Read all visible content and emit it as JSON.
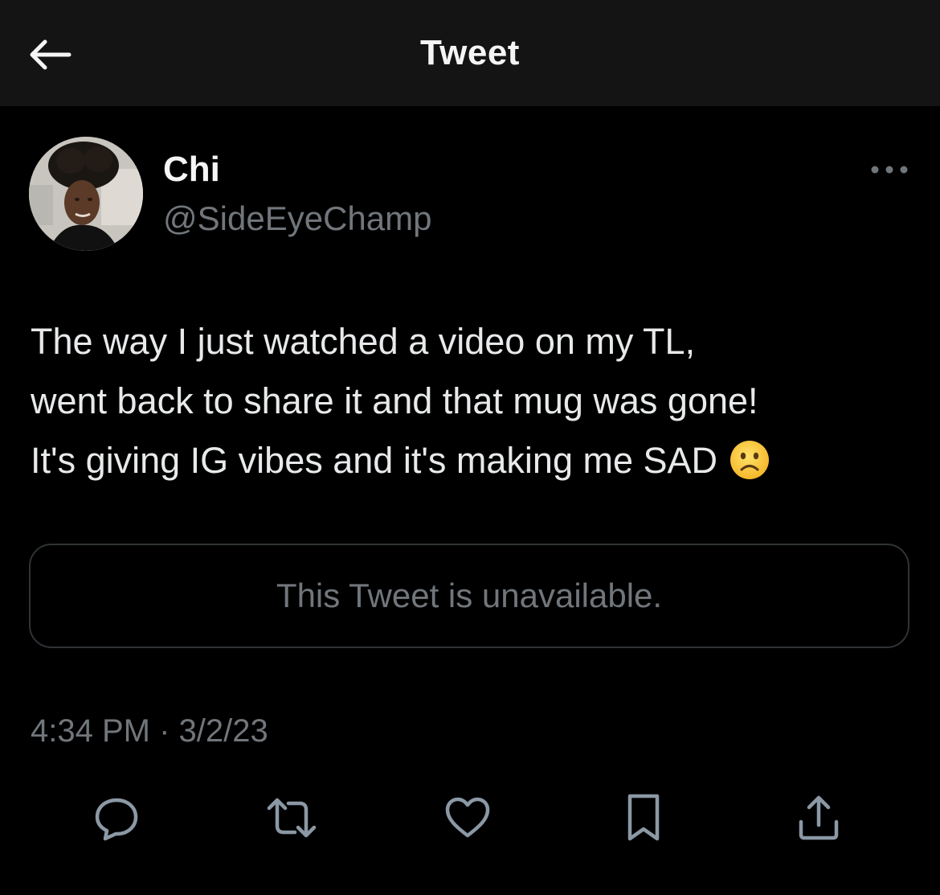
{
  "header": {
    "title": "Tweet",
    "back_icon": "arrow-left-icon"
  },
  "author": {
    "display_name": "Chi",
    "handle": "@SideEyeChamp",
    "avatar_icon": "user-avatar",
    "more_icon": "more-horizontal-icon"
  },
  "tweet": {
    "text_line_1": "The way I just watched a video on my TL,",
    "text_line_2": "went back to share it and that mug was gone!",
    "text_line_3": "It's giving IG vibes and it's making me SAD",
    "emoji": "frowning-face",
    "quoted_unavailable": "This Tweet is unavailable.",
    "time": "4:34 PM",
    "separator": "·",
    "date": "3/2/23"
  },
  "actions": [
    {
      "name": "reply",
      "icon": "comment-icon"
    },
    {
      "name": "retweet",
      "icon": "retweet-icon"
    },
    {
      "name": "like",
      "icon": "heart-icon"
    },
    {
      "name": "bookmark",
      "icon": "bookmark-icon"
    },
    {
      "name": "share",
      "icon": "share-icon"
    }
  ],
  "colors": {
    "background": "#000000",
    "header_background": "#141414",
    "primary_text": "#e7e9ea",
    "secondary_text": "#71767b",
    "border": "#2f3336"
  }
}
